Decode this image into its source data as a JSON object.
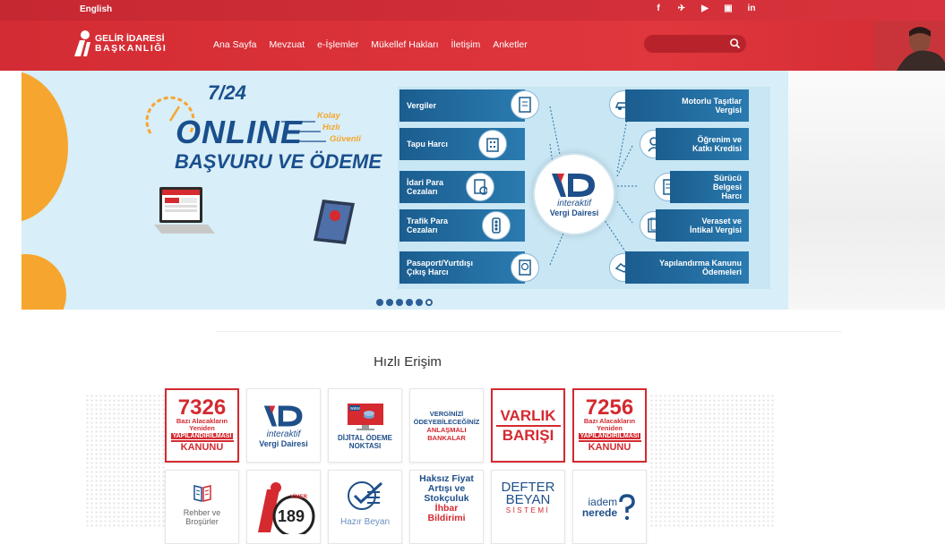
{
  "topbar": {
    "language_link": "English",
    "social": [
      {
        "name": "facebook",
        "glyph": "f"
      },
      {
        "name": "twitter",
        "glyph": "✈"
      },
      {
        "name": "youtube",
        "glyph": "▶"
      },
      {
        "name": "instagram",
        "glyph": "▣"
      },
      {
        "name": "linkedin",
        "glyph": "in"
      }
    ]
  },
  "header": {
    "logo_line1": "GELİR İDARESİ",
    "logo_line2": "BAŞKANLIĞI",
    "nav": [
      "Ana Sayfa",
      "Mevzuat",
      "e-İşlemler",
      "Mükellef Hakları",
      "İletişim",
      "Anketler"
    ],
    "search_placeholder": ""
  },
  "hero": {
    "h247": "7/24",
    "online": "ONLINE",
    "basvuru": "BAŞVURU VE ÖDEME",
    "taglines": [
      "Kolay",
      "Hızlı",
      "Güvenli"
    ],
    "left_services": [
      "Vergiler",
      "Tapu Harcı",
      "İdari Para Cezaları",
      "Trafik Para Cezaları",
      "Pasaport/Yurtdışı Çıkış Harcı"
    ],
    "right_services": [
      "Motorlu Taşıtlar Vergisi",
      "Öğrenim ve Katkı Kredisi",
      "Sürücü Belgesi Harcı",
      "Veraset ve İntikal Vergisi",
      "Yapılandırma Kanunu Ödemeleri"
    ],
    "center_logo_top": "interaktif",
    "center_logo_bottom": "Vergi Dairesi",
    "slides_total": 6,
    "active_slide": 6
  },
  "quick_access": {
    "title": "Hızlı Erişim",
    "tiles_row1": [
      {
        "big": "7326",
        "line1": "Bazı Alacakların",
        "line2": "Yeniden",
        "band": "YAPILANDIRILMASI",
        "footer": "KANUNU"
      },
      {
        "top": "interaktif",
        "bottom": "Vergi Dairesi"
      },
      {
        "line1": "DİJİTAL ÖDEME",
        "line2": "NOKTASI",
        "badge": "www"
      },
      {
        "line1": "VERGİNİZİ",
        "line2": "ÖDEYEBİLECEĞİNİZ",
        "line3": "ANLAŞMALI",
        "line4": "BANKALAR"
      },
      {
        "line1": "VARLIK",
        "line2": "BARIŞI"
      },
      {
        "big": "7256",
        "line1": "Bazı Alacakların",
        "line2": "Yeniden",
        "band": "YAPILANDIRILMASI",
        "footer": "KANUNU"
      }
    ],
    "tiles_row2": [
      {
        "line1": "Rehber ve",
        "line2": "Broşürler"
      },
      {
        "top": "VİMER",
        "number": "189"
      },
      {
        "line1": "Hazır Beyan"
      },
      {
        "line1": "Haksız Fiyat",
        "line2": "Artışı ve",
        "line3": "Stokçuluk",
        "line4": "İhbar",
        "line5": "Bildirimi"
      },
      {
        "line1": "DEFTER",
        "line2": "BEYAN",
        "line3": "SİSTEMİ"
      },
      {
        "line1": "iadem",
        "line2": "nerede"
      }
    ]
  }
}
